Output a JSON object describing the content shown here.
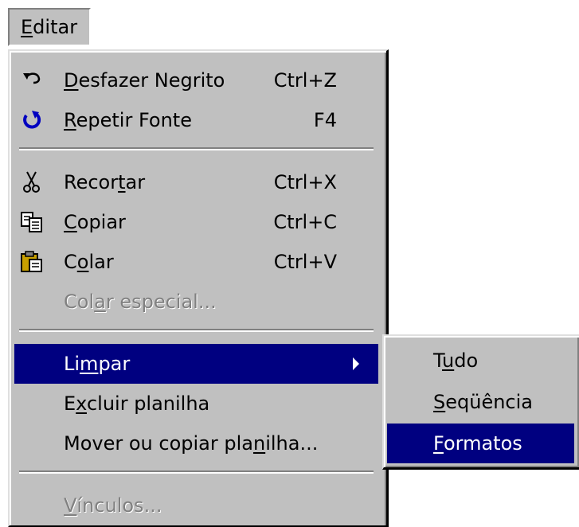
{
  "menubar": {
    "edit_menu": {
      "pre": "",
      "u": "E",
      "post": "ditar"
    }
  },
  "menu": {
    "items": [
      {
        "pre": "",
        "u": "D",
        "post": "esfazer Negrito",
        "shortcut": "Ctrl+Z",
        "icon": "undo-icon"
      },
      {
        "pre": "",
        "u": "R",
        "post": "epetir Fonte",
        "shortcut": "F4",
        "icon": "redo-icon"
      },
      {
        "pre": "Recor",
        "u": "t",
        "post": "ar",
        "shortcut": "Ctrl+X",
        "icon": "scissors-icon"
      },
      {
        "pre": "",
        "u": "C",
        "post": "opiar",
        "shortcut": "Ctrl+C",
        "icon": "copy-icon"
      },
      {
        "pre": "C",
        "u": "o",
        "post": "lar",
        "shortcut": "Ctrl+V",
        "icon": "paste-icon"
      },
      {
        "pre": "Col",
        "u": "a",
        "post": "r especial...",
        "disabled": true
      },
      {
        "pre": "Li",
        "u": "m",
        "post": "par",
        "selected": true,
        "has_submenu": true
      },
      {
        "pre": "E",
        "u": "x",
        "post": "cluir planilha"
      },
      {
        "pre": "Mover ou copiar pla",
        "u": "n",
        "post": "ilha..."
      },
      {
        "pre": "",
        "u": "V",
        "post": "ínculos...",
        "disabled": true
      }
    ]
  },
  "submenu": {
    "items": [
      {
        "pre": "T",
        "u": "u",
        "post": "do"
      },
      {
        "pre": "",
        "u": "S",
        "post": "eqüência"
      },
      {
        "pre": "",
        "u": "F",
        "post": "ormatos",
        "selected": true
      }
    ]
  },
  "colors": {
    "menu_bg": "#c0c0c0",
    "highlight": "#000080",
    "highlight_text": "#ffffff",
    "disabled_text": "#808080"
  }
}
